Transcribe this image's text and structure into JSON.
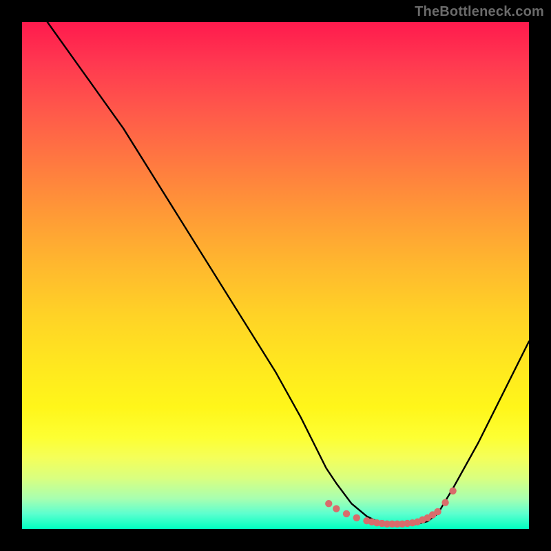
{
  "watermark": "TheBottleneck.com",
  "chart_data": {
    "type": "line",
    "title": "",
    "xlabel": "",
    "ylabel": "",
    "xlim": [
      0,
      100
    ],
    "ylim": [
      0,
      100
    ],
    "grid": false,
    "background": "rainbow-vertical-gradient",
    "series": [
      {
        "name": "bottleneck-curve",
        "x": [
          5,
          10,
          15,
          20,
          25,
          30,
          35,
          40,
          45,
          50,
          55,
          57,
          60,
          62,
          65,
          68,
          70,
          72,
          74,
          76,
          78,
          80,
          82,
          85,
          90,
          95,
          100
        ],
        "y": [
          100,
          93,
          86,
          79,
          71,
          63,
          55,
          47,
          39,
          31,
          22,
          18,
          12,
          9,
          5,
          2.5,
          1.5,
          1,
          0.8,
          0.8,
          1,
          1.5,
          3,
          8,
          17,
          27,
          37
        ]
      }
    ],
    "markers": {
      "name": "optimal-zone-dots",
      "color": "#d96b6b",
      "points": [
        {
          "x": 60.5,
          "y": 5.0
        },
        {
          "x": 62.0,
          "y": 4.0
        },
        {
          "x": 64.0,
          "y": 3.0
        },
        {
          "x": 66.0,
          "y": 2.2
        },
        {
          "x": 68.0,
          "y": 1.6
        },
        {
          "x": 69.0,
          "y": 1.4
        },
        {
          "x": 70.0,
          "y": 1.2
        },
        {
          "x": 71.0,
          "y": 1.1
        },
        {
          "x": 72.0,
          "y": 1.0
        },
        {
          "x": 73.0,
          "y": 1.0
        },
        {
          "x": 74.0,
          "y": 1.0
        },
        {
          "x": 75.0,
          "y": 1.0
        },
        {
          "x": 76.0,
          "y": 1.1
        },
        {
          "x": 77.0,
          "y": 1.2
        },
        {
          "x": 78.0,
          "y": 1.4
        },
        {
          "x": 79.0,
          "y": 1.8
        },
        {
          "x": 80.0,
          "y": 2.2
        },
        {
          "x": 81.0,
          "y": 2.8
        },
        {
          "x": 82.0,
          "y": 3.4
        },
        {
          "x": 83.5,
          "y": 5.2
        },
        {
          "x": 85.0,
          "y": 7.5
        }
      ]
    }
  }
}
